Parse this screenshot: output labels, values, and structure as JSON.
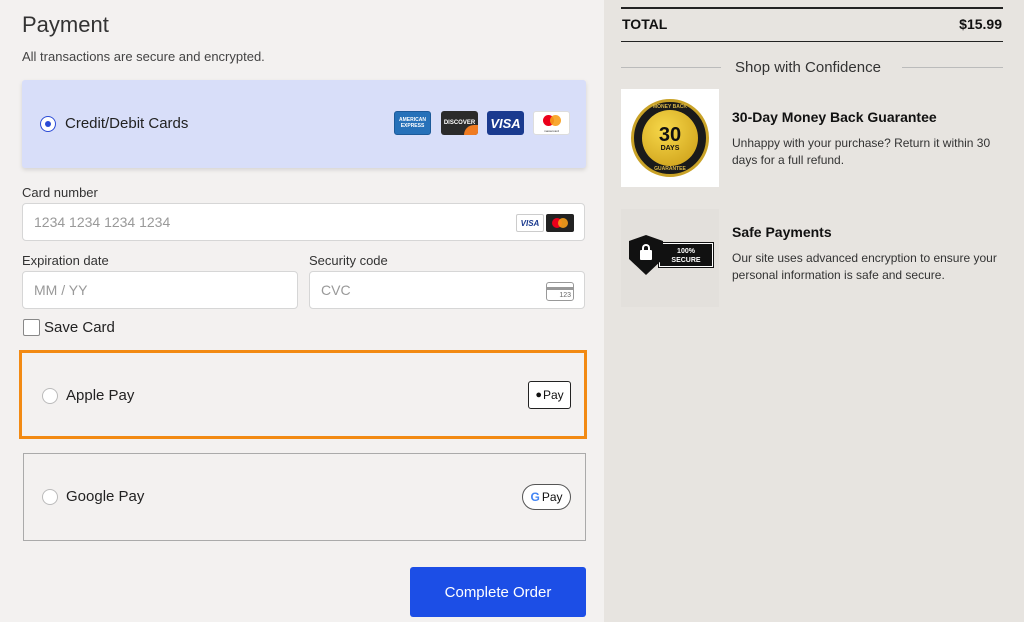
{
  "payment": {
    "title": "Payment",
    "subtitle": "All transactions are secure and encrypted.",
    "card_option": {
      "label": "Credit/Debit Cards",
      "selected": true,
      "brands": [
        "AMERICAN EXPRESS",
        "DISCOVER",
        "VISA",
        "mastercard"
      ]
    },
    "card_number": {
      "label": "Card number",
      "placeholder": "1234 1234 1234 1234"
    },
    "expiration": {
      "label": "Expiration date",
      "placeholder": "MM / YY"
    },
    "security": {
      "label": "Security code",
      "placeholder": "CVC",
      "icon_text": "123"
    },
    "save_card": {
      "label": "Save Card",
      "checked": false
    },
    "apple_pay": {
      "label": "Apple Pay",
      "badge": "Pay",
      "highlight_color": "#f28a13"
    },
    "google_pay": {
      "label": "Google Pay",
      "badge": "Pay"
    },
    "complete_button": "Complete Order"
  },
  "summary": {
    "total_label": "TOTAL",
    "total_value": "$15.99",
    "confidence_heading": "Shop with Confidence",
    "features": [
      {
        "icon": "money-back-seal-icon",
        "seal_top": "MONEY BACK",
        "seal_number": "30",
        "seal_days": "DAYS",
        "seal_bottom": "GUARANTEE",
        "title": "30-Day Money Back Guarantee",
        "description": "Unhappy with your purchase? Return it within 30 days for a full refund."
      },
      {
        "icon": "secure-shield-icon",
        "badge_line1": "100%",
        "badge_line2": "SECURE",
        "title": "Safe Payments",
        "description": "Our site uses advanced encryption to ensure your personal information is safe and secure."
      }
    ]
  },
  "colors": {
    "accent": "#1c4ee6",
    "selected_bg": "#d8def9",
    "highlight": "#f28a13"
  }
}
